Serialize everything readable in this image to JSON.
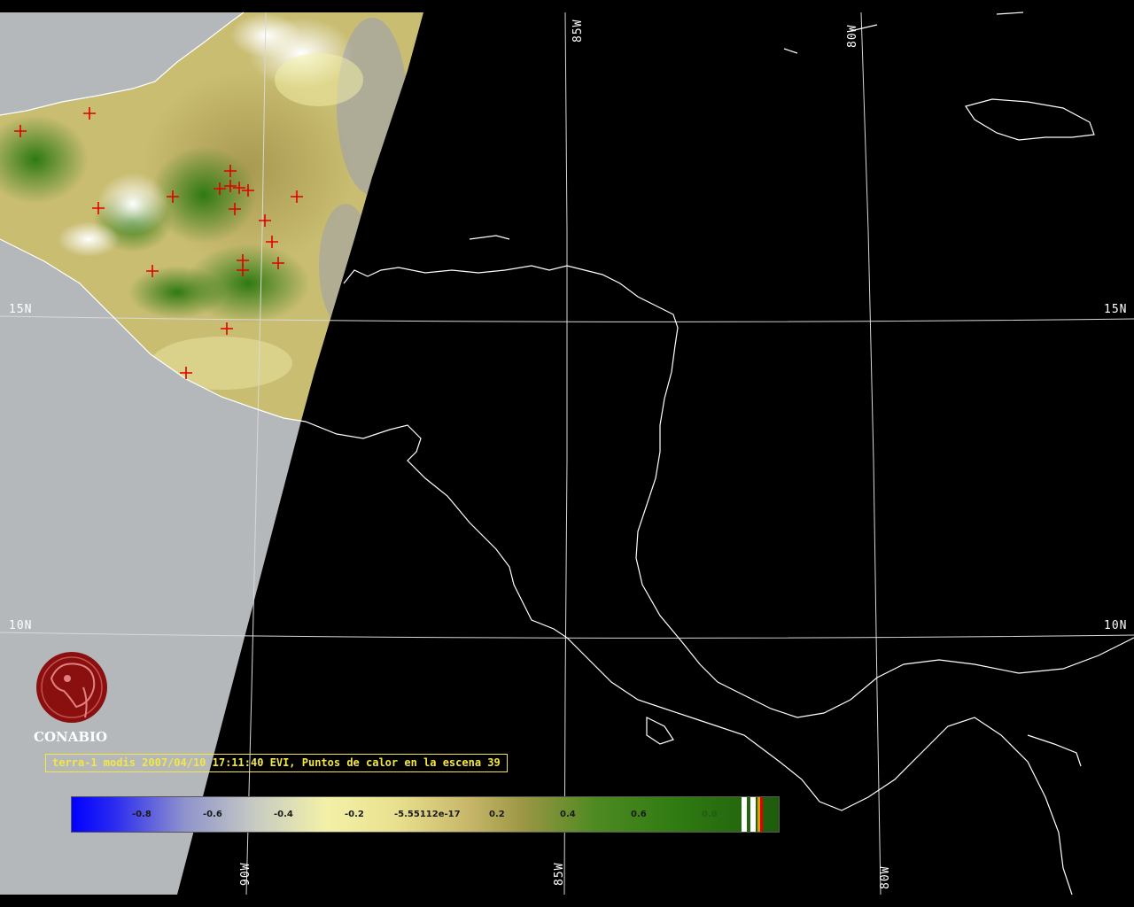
{
  "grid_labels": {
    "lon_85w_top": "85W",
    "lon_80w_top": "80W",
    "lat_15n_left": "15N",
    "lat_15n_right": "15N",
    "lat_10n_left": "10N",
    "lat_10n_right": "10N",
    "lon_90w_bottom": "90W",
    "lon_85w_bottom": "85W",
    "lon_80w_bottom": "80W"
  },
  "logo": {
    "text": "CONABIO",
    "icon": "conabio-macaw-logo-icon"
  },
  "caption": "terra-1 modis 2007/04/10 17:11:40 EVI, Puntos de calor en la escena 39",
  "colorbar": {
    "ticks": [
      "-0.8",
      "-0.6",
      "-0.4",
      "-0.2",
      "-5.55112e-17",
      "0.2",
      "0.4",
      "0.6",
      "0.8"
    ]
  },
  "colors": {
    "background": "#000000",
    "no_data": "#b4b8bb",
    "coastline": "#ffffff",
    "caption": "#f5e642",
    "hotspot": "#e00000",
    "logo": "#8a1010"
  },
  "hotspot_icon": "red-cross-icon"
}
